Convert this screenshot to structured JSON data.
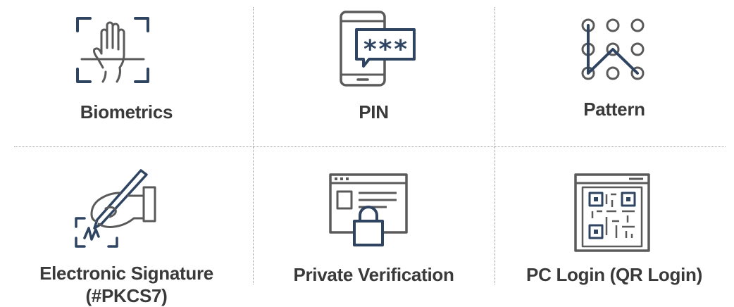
{
  "colors": {
    "icon_gray": "#5a5a5a",
    "icon_navy": "#2f4461",
    "label": "#3a3a3a",
    "divider": "#9a9a9a"
  },
  "items": [
    {
      "id": "biometrics",
      "icon": "hand-scan-icon",
      "label_lines": [
        "Biometrics"
      ]
    },
    {
      "id": "pin",
      "icon": "phone-pin-icon",
      "label_lines": [
        "PIN"
      ]
    },
    {
      "id": "pattern",
      "icon": "pattern-grid-icon",
      "label_lines": [
        "Pattern"
      ]
    },
    {
      "id": "electronic-signature",
      "icon": "hand-signature-icon",
      "label_lines": [
        "Electronic Signature",
        "(#PKCS7)"
      ]
    },
    {
      "id": "private-verification",
      "icon": "browser-lock-icon",
      "label_lines": [
        "Private Verification"
      ]
    },
    {
      "id": "pc-login",
      "icon": "qr-window-icon",
      "label_lines": [
        "PC Login (QR Login)"
      ]
    }
  ],
  "pin_icon_text": "***"
}
